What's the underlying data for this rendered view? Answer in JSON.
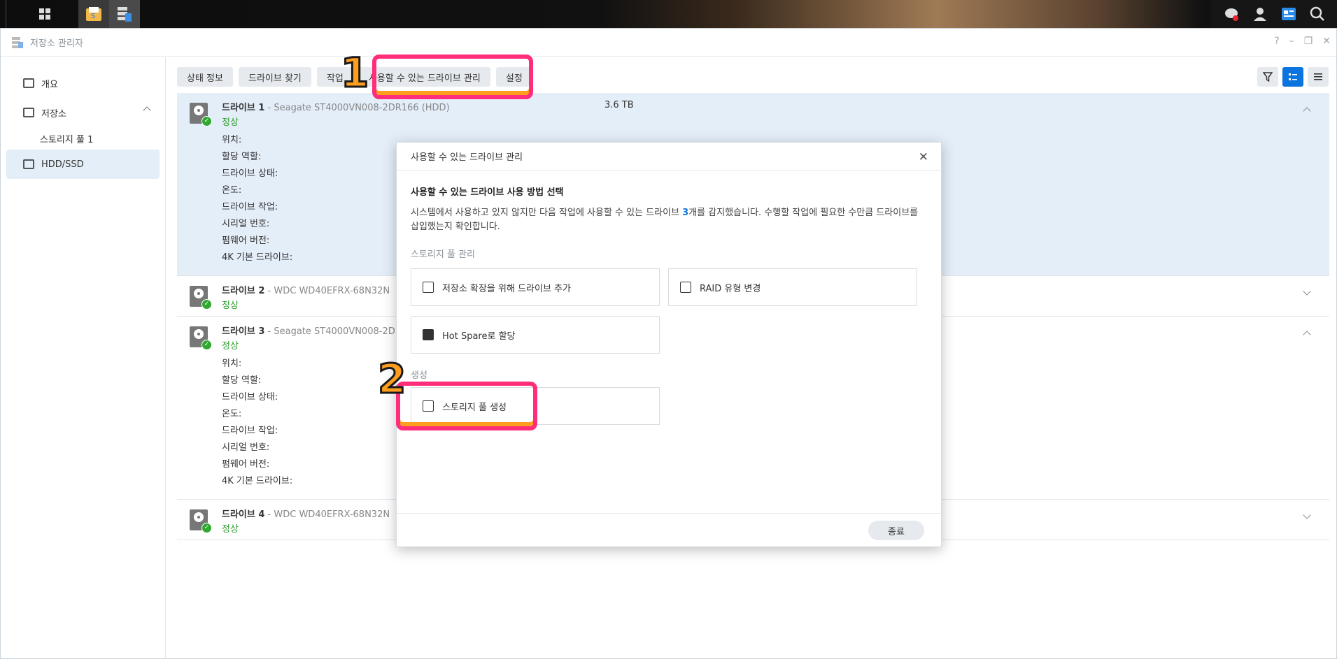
{
  "app": {
    "title": "저장소 관리자"
  },
  "sidebar": {
    "items": [
      {
        "label": "개요"
      },
      {
        "label": "저장소"
      },
      {
        "label": "스토리지 풀 1"
      },
      {
        "label": "HDD/SSD"
      }
    ]
  },
  "toolbar": {
    "buttons": [
      {
        "label": "상태 정보"
      },
      {
        "label": "드라이브 찾기"
      },
      {
        "label": "작업"
      },
      {
        "label": "사용할 수 있는 드라이브 관리"
      },
      {
        "label": "설정"
      }
    ]
  },
  "drives": [
    {
      "name": "드라이브 1",
      "model": " - Seagate ST4000VN008-2DR166 (HDD)",
      "status": "정상",
      "size": "3.6 TB"
    },
    {
      "name": "드라이브 2",
      "model": " - WDC WD40EFRX-68N32N",
      "status": "정상"
    },
    {
      "name": "드라이브 3",
      "model": " - Seagate ST4000VN008-2D",
      "status": "정상"
    },
    {
      "name": "드라이브 4",
      "model": " - WDC WD40EFRX-68N32N",
      "status": "정상"
    }
  ],
  "drive_props": [
    "위치:",
    "할당 역할:",
    "드라이브 상태:",
    "온도:",
    "드라이브 작업:",
    "시리얼 번호:",
    "펌웨어 버전:",
    "4K 기본 드라이브:"
  ],
  "dialog": {
    "title": "사용할 수 있는 드라이브 관리",
    "heading": "사용할 수 있는 드라이브 사용 방법 선택",
    "desc_pre": "시스템에서 사용하고 있지 않지만 다음 작업에 사용할 수 있는 드라이브 ",
    "desc_num": "3",
    "desc_post": "개를 감지했습니다. 수행할 작업에 필요한 수만큼 드라이브를 삽입했는지 확인합니다.",
    "section_pool": "스토리지 풀 관리",
    "opt_add": "저장소 확장을 위해 드라이브 추가",
    "opt_raid": "RAID 유형 변경",
    "opt_hotspare": "Hot Spare로 할당",
    "section_create": "생성",
    "opt_create": "스토리지 풀 생성",
    "close_label": "종료"
  },
  "annotations": {
    "step1": "1",
    "step2": "2"
  },
  "colors": {
    "accent": "#0b74de",
    "ok": "#2fa82f",
    "highlight_outer": "#ff2d7a",
    "highlight_inner": "#ff9d1e"
  }
}
